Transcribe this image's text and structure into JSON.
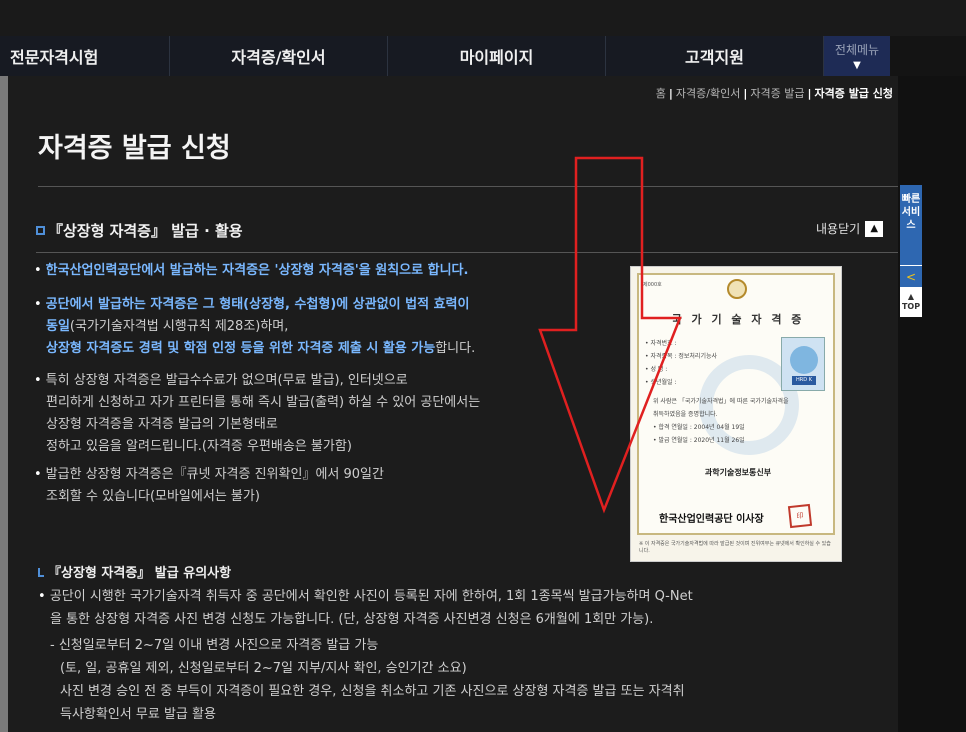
{
  "nav": {
    "items": [
      "전문자격시험",
      "자격증/확인서",
      "마이페이지",
      "고객지원"
    ],
    "all_menu": "전체메뉴",
    "all_menu_icon": "chevron-down-icon"
  },
  "breadcrumb": {
    "home": "홈",
    "level1": "자격증/확인서",
    "level2": "자격증 발급",
    "current": "자격증 발급 신청"
  },
  "page_title": "자격증 발급 신청",
  "section": {
    "title": "『상장형 자격증』 발급 · 활용",
    "close_label": "내용닫기",
    "close_icon": "chevron-up-icon"
  },
  "bullets": {
    "b1": "한국산업인력공단에서 발급하는 자격증은 '상장형 자격증'을 원칙으로 합니다.",
    "b2_l1": "공단에서 발급하는 자격증은 그 형태(상장형, 수첩형)에 상관없이 법적 효력이",
    "b2_l2_bold": "동일",
    "b2_l2_rest": "(국가기술자격법 시행규칙 제28조)하며,",
    "b2_l3_bold": "상장형 자격증도 경력 및 학점 인정 등을 위한 자격증 제출 시 활용 가능",
    "b2_l3_rest": "합니다.",
    "b3": [
      "특히 상장형 자격증은 발급수수료가 없으며(무료 발급), 인터넷으로",
      "편리하게 신청하고 자가 프린터를 통해 즉시 발급(출력) 하실 수 있어 공단에서는",
      "상장형 자격증을 자격증 발급의 기본형태로",
      "정하고 있음을 알려드립니다.(자격증 우편배송은 불가함)"
    ],
    "b4": [
      "발급한 상장형 자격증은『큐넷 자격증 진위확인』에서 90일간",
      "조회할 수 있습니다(모바일에서는 불가)"
    ]
  },
  "certificate": {
    "number": "제000호",
    "title": "국 가 기 술 자 격 증",
    "fields": [
      "• 자격번호 :",
      "• 자격종목 :  정보처리기능사",
      "• 성    명 :",
      "• 생년월일 :"
    ],
    "mascot_tag": "HRD K",
    "body": [
      "위 사람은 「국가기술자격법」에 따른 국가기술자격을",
      "취득하였음을 증명합니다.",
      "• 합격 연월일 : 2004년 04월 19일",
      "• 발급 연월일 : 2020년 11월 26일"
    ],
    "ministry": "과학기술정보통신부",
    "issuer": "한국산업인력공단 이사장",
    "seal": "印",
    "footnote": "※ 이 자격증은 국가기술자격법에 따라 발급된 것이며 진위여부는 큐넷에서 확인하실 수 있습니다."
  },
  "notes": {
    "title": "『상장형 자격증』 발급 유의사항",
    "n1_l1": "공단이 시행한 국가기술자격 취득자 중 공단에서 확인한 사진이 등록된 자에 한하여, 1회 1종목씩 발급가능하며 Q-Net",
    "n1_l2": "을 통한 상장형 자격증 사진 변경 신청도 가능합니다. (단, 상장형 자격증 사진변경 신청은 6개월에 1회만 가능).",
    "sub_l1": "- 신청일로부터 2~7일 이내 변경 사진으로 자격증 발급 가능",
    "sub_l2": "(토, 일, 공휴일 제외, 신청일로부터 2~7일 지부/지사 확인, 승인기간 소요)",
    "sub_l3": "사진 변경 승인 전 중 부득이 자격증이 필요한 경우, 신청을 취소하고 기존 사진으로 상장형 자격증 발급 또는 자격취",
    "sub_l4": "득사항확인서 무료 발급 활용"
  },
  "quick_service": {
    "label": "빠른서비스",
    "collapse_icon": "chevron-left-icon",
    "top_label": "TOP"
  },
  "colors": {
    "accent_blue": "#7ab8ff",
    "annotation_red": "#e02020",
    "quick_blue": "#2e67b1"
  }
}
